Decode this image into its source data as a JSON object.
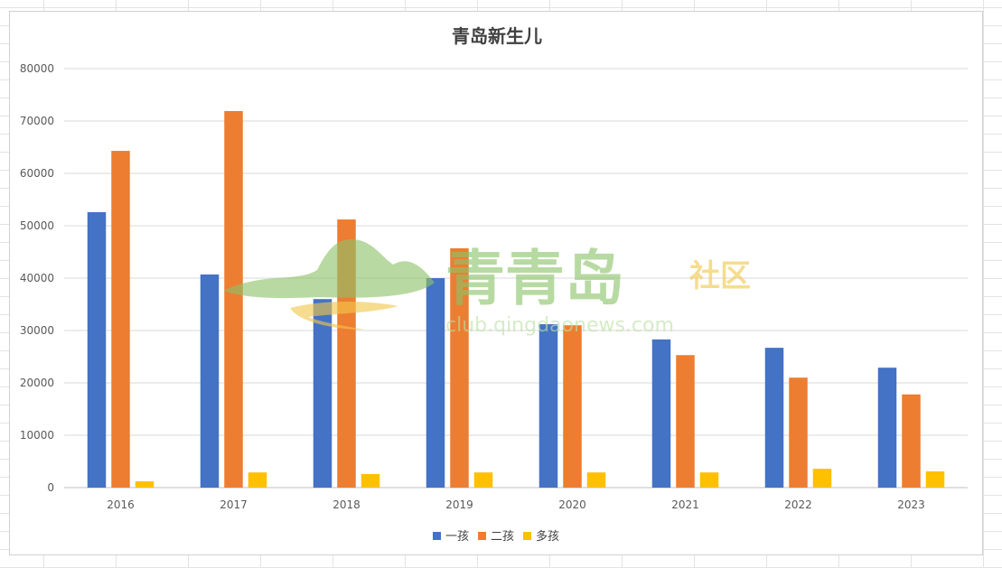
{
  "chart_data": {
    "type": "bar",
    "title": "青岛新生儿",
    "categories": [
      "2016",
      "2017",
      "2018",
      "2019",
      "2020",
      "2021",
      "2022",
      "2023"
    ],
    "series": [
      {
        "name": "一孩",
        "color": "#4472C4",
        "values": [
          52600,
          40700,
          36000,
          40000,
          31200,
          28300,
          26700,
          22900
        ]
      },
      {
        "name": "二孩",
        "color": "#ED7D31",
        "values": [
          64300,
          71900,
          51200,
          45700,
          31000,
          25300,
          21000,
          17800
        ]
      },
      {
        "name": "多孩",
        "color": "#FFC000",
        "values": [
          1200,
          2900,
          2600,
          2900,
          2900,
          2900,
          3600,
          3100
        ]
      }
    ],
    "ylim": [
      0,
      80000
    ],
    "yticks": [
      0,
      10000,
      20000,
      30000,
      40000,
      50000,
      60000,
      70000,
      80000
    ],
    "xlabel": "",
    "ylabel": "",
    "grid": true,
    "legend": "bottom"
  },
  "watermark": {
    "brand": "青青岛",
    "suffix": "社区",
    "url": "club.qingdaonews.com"
  }
}
